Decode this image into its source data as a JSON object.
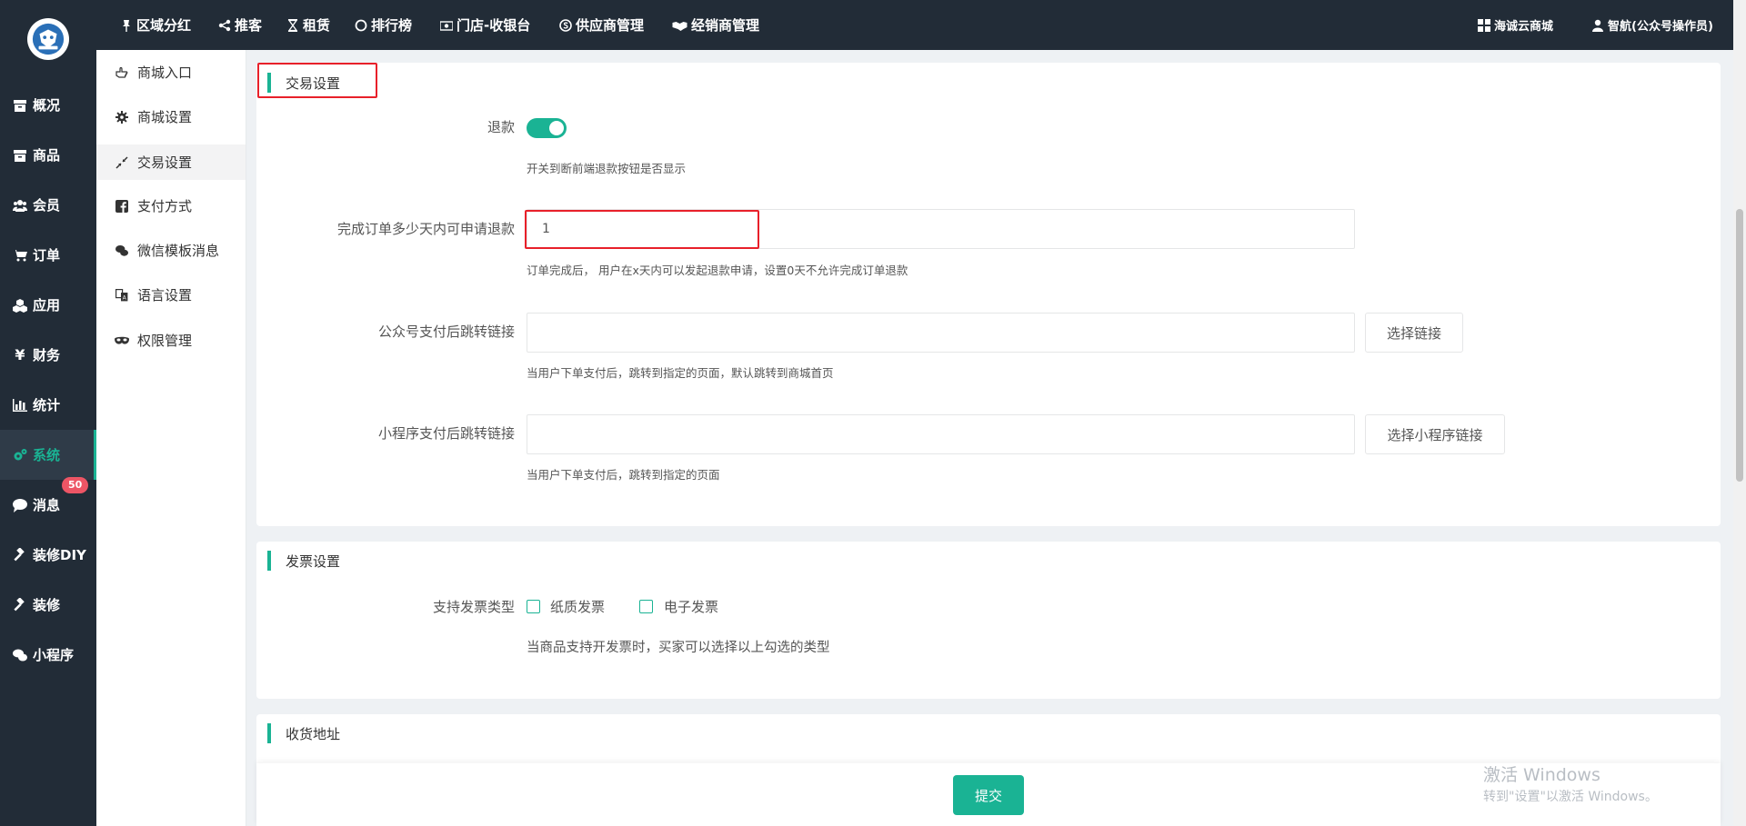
{
  "top_nav": {
    "items": [
      {
        "label": "区域分红",
        "icon": "pin-icon"
      },
      {
        "label": "推客",
        "icon": "share-icon"
      },
      {
        "label": "租赁",
        "icon": "hourglass-icon"
      },
      {
        "label": "排行榜",
        "icon": "circle-icon"
      },
      {
        "label": "门店-收银台",
        "icon": "money-icon"
      },
      {
        "label": "供应商管理",
        "icon": "skype-icon"
      },
      {
        "label": "经销商管理",
        "icon": "handshake-icon"
      }
    ],
    "shop_name": "海诚云商城",
    "user": "智航(公众号操作员)"
  },
  "sidebar": {
    "items": [
      {
        "label": "概况",
        "icon": "archive-icon"
      },
      {
        "label": "商品",
        "icon": "box-icon"
      },
      {
        "label": "会员",
        "icon": "users-icon"
      },
      {
        "label": "订单",
        "icon": "cart-icon"
      },
      {
        "label": "应用",
        "icon": "cubes-icon"
      },
      {
        "label": "财务",
        "icon": "yen-icon"
      },
      {
        "label": "统计",
        "icon": "bar-chart-icon"
      },
      {
        "label": "系统",
        "icon": "gears-icon",
        "active": true
      },
      {
        "label": "消息",
        "icon": "comment-icon",
        "badge": "50"
      },
      {
        "label": "装修DIY",
        "icon": "gavel-icon"
      },
      {
        "label": "装修",
        "icon": "gavel-icon"
      },
      {
        "label": "小程序",
        "icon": "wechat-icon"
      }
    ]
  },
  "subnav": {
    "items": [
      {
        "label": "商城入口",
        "icon": "hand-icon"
      },
      {
        "label": "商城设置",
        "icon": "gear-icon"
      },
      {
        "label": "交易设置",
        "icon": "compress-icon",
        "active": true
      },
      {
        "label": "支付方式",
        "icon": "facebook-square-icon"
      },
      {
        "label": "微信模板消息",
        "icon": "wechat-icon"
      },
      {
        "label": "语言设置",
        "icon": "translate-icon"
      },
      {
        "label": "权限管理",
        "icon": "mask-icon"
      }
    ]
  },
  "trade": {
    "title": "交易设置",
    "refund_label": "退款",
    "refund_enabled": true,
    "refund_help": "开关到断前端退款按钮是否显示",
    "days_label": "完成订单多少天内可申请退款",
    "days_value": "1",
    "days_help": "订单完成后， 用户在x天内可以发起退款申请，设置0天不允许完成订单退款",
    "mp_link_label": "公众号支付后跳转链接",
    "mp_link_value": "",
    "mp_link_button": "选择链接",
    "mp_link_help": "当用户下单支付后，跳转到指定的页面，默认跳转到商城首页",
    "mini_link_label": "小程序支付后跳转链接",
    "mini_link_value": "",
    "mini_link_button": "选择小程序链接",
    "mini_link_help": "当用户下单支付后，跳转到指定的页面"
  },
  "invoice": {
    "title": "发票设置",
    "type_label": "支持发票类型",
    "options": [
      "纸质发票",
      "电子发票"
    ],
    "help": "当商品支持开发票时，买家可以选择以上勾选的类型"
  },
  "address": {
    "title": "收货地址"
  },
  "footer": {
    "submit_label": "提交"
  },
  "watermark": {
    "line1": "激活 Windows",
    "line2": "转到\"设置\"以激活 Windows。"
  },
  "colors": {
    "sidebar_bg": "#222c37",
    "accent": "#1ab394",
    "badge": "#ed5565",
    "highlight_border": "#e8202a"
  }
}
